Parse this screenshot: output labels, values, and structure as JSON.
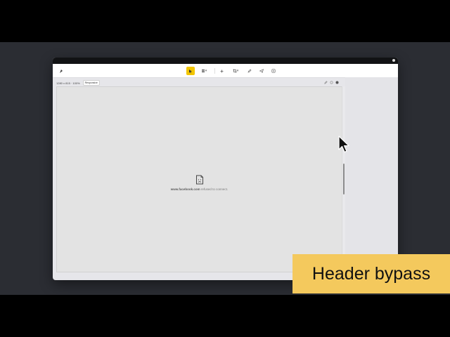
{
  "toolbar": {
    "icons": [
      "logo-icon",
      "cursor-select-icon",
      "layers-icon",
      "plus-icon",
      "crop-icon",
      "pen-icon",
      "send-icon",
      "settings-icon"
    ]
  },
  "viewport": {
    "dimensions": "1280 x 815 · 100%",
    "mode_badge": "Responsive"
  },
  "frame": {
    "error_domain": "www.facebook.com",
    "error_text": "refused to connect."
  },
  "caption": {
    "text": "Header bypass"
  },
  "colors": {
    "accent": "#f2c500",
    "caption_bg": "#f4c95d",
    "stage_bg": "#2b2d33"
  }
}
